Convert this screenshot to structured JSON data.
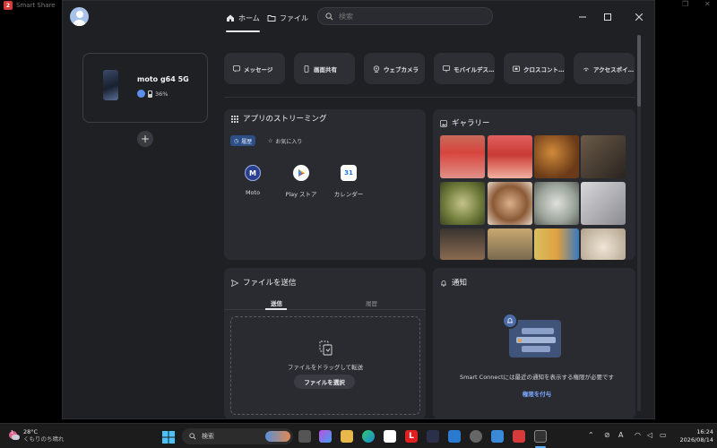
{
  "desktop": {
    "app_title": "Smart Share",
    "app_icon_text": "2"
  },
  "nav": {
    "home_label": "ホーム",
    "files_label": "ファイル",
    "search_placeholder": "検索"
  },
  "device": {
    "name": "moto g64 5G",
    "battery": "36%"
  },
  "quick_actions": [
    {
      "label": "メッセージ",
      "icon": "message-icon"
    },
    {
      "label": "画面共有",
      "icon": "phone-screen-icon"
    },
    {
      "label": "ウェブカメラ",
      "icon": "webcam-icon"
    },
    {
      "label": "モバイルデス…",
      "icon": "monitor-icon"
    },
    {
      "label": "クロスコント…",
      "icon": "cross-control-icon"
    },
    {
      "label": "アクセスポイ…",
      "icon": "hotspot-icon"
    }
  ],
  "streaming": {
    "title": "アプリのストリーミング",
    "chip_history": "履歴",
    "chip_favorites": "お気に入り",
    "apps": [
      {
        "label": "Moto",
        "color": "#2a3f8f"
      },
      {
        "label": "Play ストア",
        "color": "#ffffff"
      },
      {
        "label": "カレンダー",
        "color": "#ffffff"
      }
    ]
  },
  "gallery": {
    "title": "ギャラリー"
  },
  "send_files": {
    "title": "ファイルを送信",
    "tab_send": "送信",
    "tab_history": "履歴",
    "drop_text": "ファイルをドラッグして転送",
    "select_button": "ファイルを選択"
  },
  "notifications": {
    "title": "通知",
    "message": "Smart Connectには最近の通知を表示する権限が必要です",
    "grant_link": "権限を付与"
  },
  "taskbar": {
    "temperature": "28°C",
    "weather": "くもりのち晴れ",
    "search_placeholder": "検索",
    "badge_count": "1",
    "time": "16:24",
    "date": "2026/08/14"
  },
  "colors": {
    "accent": "#5c8ef0",
    "link": "#7aa7ff",
    "chip_active_bg": "#2c4f86"
  }
}
